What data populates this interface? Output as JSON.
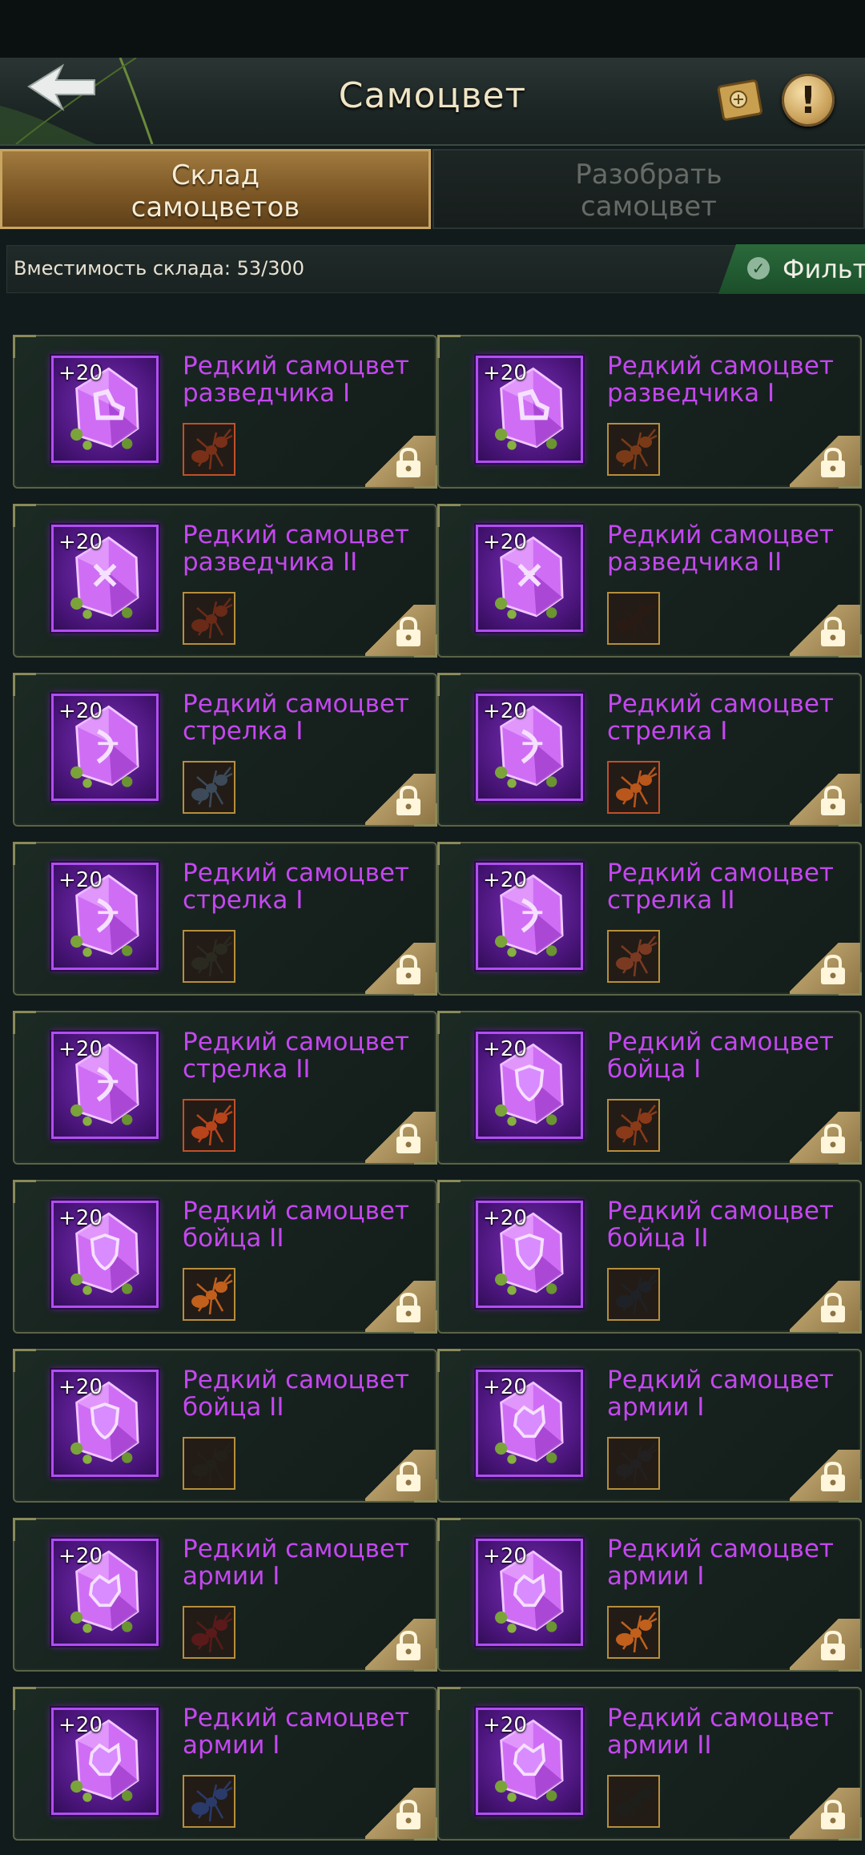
{
  "header": {
    "title": "Самоцвет",
    "back_icon": "back-arrow-icon",
    "journal_icon": "journal-book-icon",
    "help_icon": "exclamation-icon",
    "help_symbol": "!"
  },
  "tabs": [
    {
      "label_line1": "Склад",
      "label_line2": "самоцветов",
      "active": true
    },
    {
      "label_line1": "Разобрать",
      "label_line2": "самоцвет",
      "active": false
    }
  ],
  "storage": {
    "capacity_label": "Вместимость склада: 53/300",
    "filter_label": "Фильт",
    "filter_icon": "check-circle-icon"
  },
  "colors": {
    "gem_name": "#c447f0",
    "gem_frame": "#b04ef0",
    "tab_active": "#8a6430",
    "filter_green": "#236034",
    "lock_gold": "#b39a65"
  },
  "gems": [
    {
      "bonus": "+20",
      "name_line1": "Редкий самоцвет",
      "name_line2": "разведчика I",
      "symbol": "boot-icon",
      "unit_color": "#7a3018",
      "border": "#c0502a",
      "locked": true
    },
    {
      "bonus": "+20",
      "name_line1": "Редкий самоцвет",
      "name_line2": "разведчика I",
      "symbol": "boot-icon",
      "unit_color": "#7a3a18",
      "border": "#b78e3c",
      "locked": true
    },
    {
      "bonus": "+20",
      "name_line1": "Редкий самоцвет",
      "name_line2": "разведчика II",
      "symbol": "scout-icon",
      "unit_color": "#6a2a18",
      "border": "#b78e3c",
      "locked": true
    },
    {
      "bonus": "+20",
      "name_line1": "Редкий самоцвет",
      "name_line2": "разведчика II",
      "symbol": "scout-icon",
      "unit_color": "#2a1a14",
      "border": "#b78e3c",
      "locked": true
    },
    {
      "bonus": "+20",
      "name_line1": "Редкий самоцвет",
      "name_line2": "стрелка I",
      "symbol": "bow-icon",
      "unit_color": "#3c4a5a",
      "border": "#b78e3c",
      "locked": true
    },
    {
      "bonus": "+20",
      "name_line1": "Редкий самоцвет",
      "name_line2": "стрелка I",
      "symbol": "bow-icon",
      "unit_color": "#b8561c",
      "border": "#c0502a",
      "locked": true
    },
    {
      "bonus": "+20",
      "name_line1": "Редкий самоцвет",
      "name_line2": "стрелка I",
      "symbol": "bow-icon",
      "unit_color": "#2a2a20",
      "border": "#b78e3c",
      "locked": true
    },
    {
      "bonus": "+20",
      "name_line1": "Редкий самоцвет",
      "name_line2": "стрелка II",
      "symbol": "bow-icon",
      "unit_color": "#7a3a22",
      "border": "#b78e3c",
      "locked": true
    },
    {
      "bonus": "+20",
      "name_line1": "Редкий самоцвет",
      "name_line2": "стрелка II",
      "symbol": "bow-icon",
      "unit_color": "#b8441c",
      "border": "#c0502a",
      "locked": true
    },
    {
      "bonus": "+20",
      "name_line1": "Редкий самоцвет",
      "name_line2": "бойца I",
      "symbol": "shield-icon",
      "unit_color": "#8a3a18",
      "border": "#b78e3c",
      "locked": true
    },
    {
      "bonus": "+20",
      "name_line1": "Редкий самоцвет",
      "name_line2": "бойца II",
      "symbol": "shield-icon",
      "unit_color": "#c0601c",
      "border": "#b78e3c",
      "locked": true
    },
    {
      "bonus": "+20",
      "name_line1": "Редкий самоцвет",
      "name_line2": "бойца II",
      "symbol": "shield-icon",
      "unit_color": "#1e2226",
      "border": "#b78e3c",
      "locked": true
    },
    {
      "bonus": "+20",
      "name_line1": "Редкий самоцвет",
      "name_line2": "бойца II",
      "symbol": "shield-icon",
      "unit_color": "#222018",
      "border": "#b78e3c",
      "locked": true
    },
    {
      "bonus": "+20",
      "name_line1": "Редкий самоцвет",
      "name_line2": "армии I",
      "symbol": "army-icon",
      "unit_color": "#222020",
      "border": "#b78e3c",
      "locked": true
    },
    {
      "bonus": "+20",
      "name_line1": "Редкий самоцвет",
      "name_line2": "армии I",
      "symbol": "army-icon",
      "unit_color": "#5a1a1a",
      "border": "#b78e3c",
      "locked": true
    },
    {
      "bonus": "+20",
      "name_line1": "Редкий самоцвет",
      "name_line2": "армии I",
      "symbol": "army-icon",
      "unit_color": "#c0601c",
      "border": "#b78e3c",
      "locked": true
    },
    {
      "bonus": "+20",
      "name_line1": "Редкий самоцвет",
      "name_line2": "армии I",
      "symbol": "army-icon",
      "unit_color": "#2a3a6a",
      "border": "#b78e3c",
      "locked": true
    },
    {
      "bonus": "+20",
      "name_line1": "Редкий самоцвет",
      "name_line2": "армии II",
      "symbol": "army-icon",
      "unit_color": "#1e1e1a",
      "border": "#b78e3c",
      "locked": true
    }
  ]
}
